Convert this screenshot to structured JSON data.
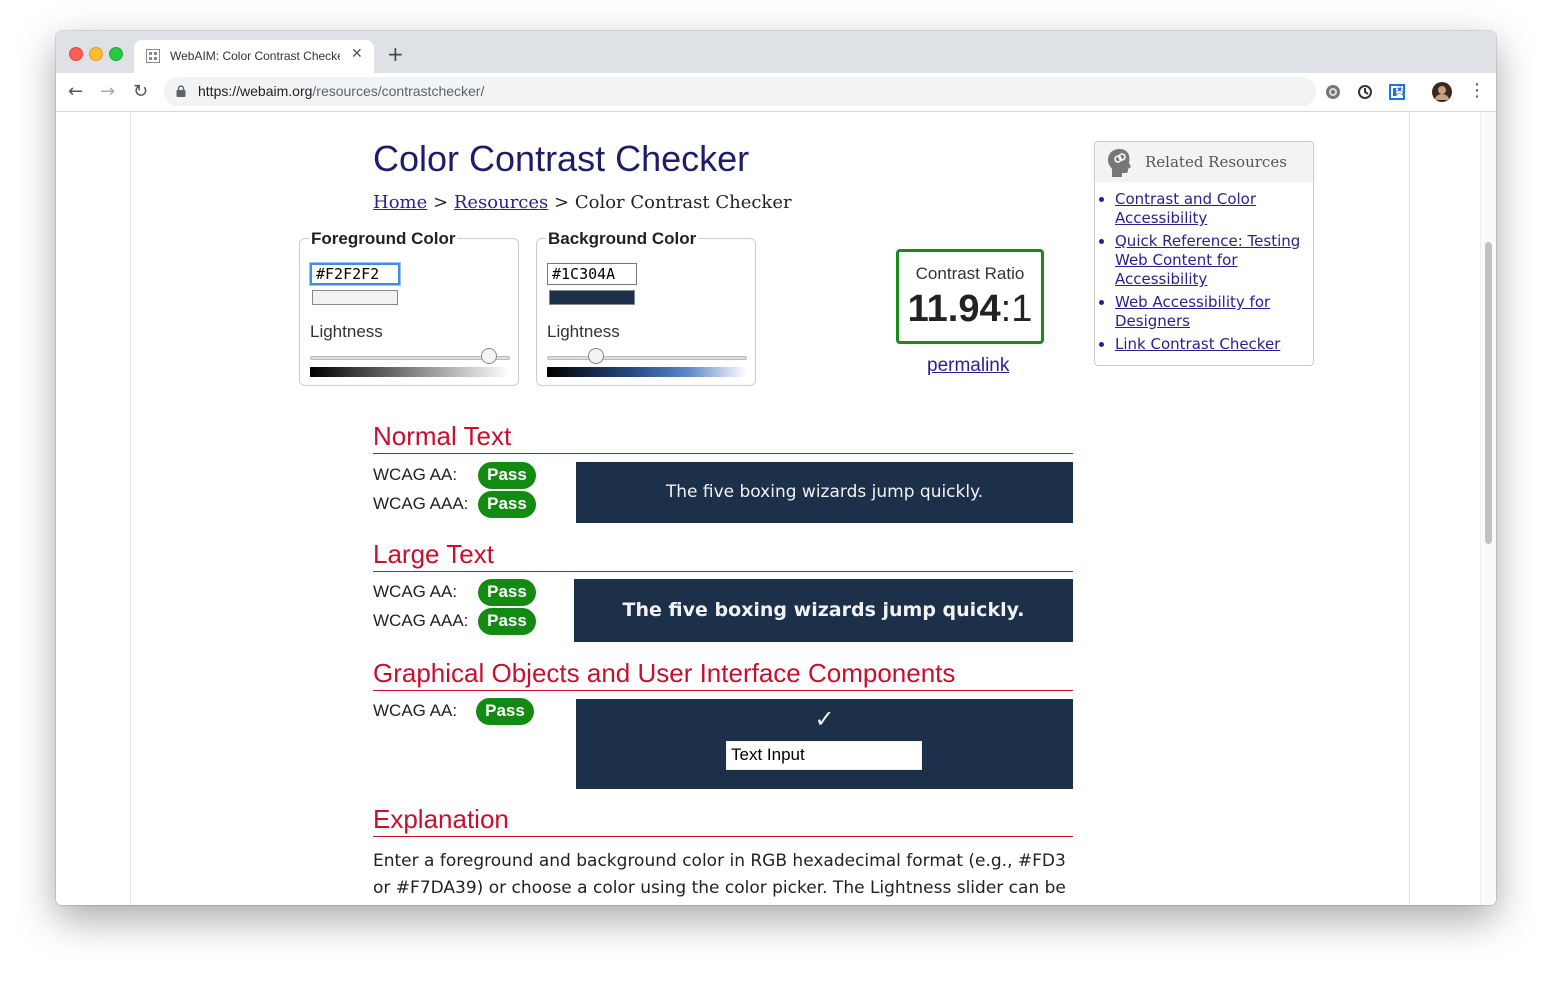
{
  "browser": {
    "tab_title": "WebAIM: Color Contrast Checker",
    "url_host": "https://webaim.org",
    "url_path": "/resources/contrastchecker/"
  },
  "page": {
    "title": "Color Contrast Checker",
    "breadcrumb": {
      "home": "Home",
      "sep1": ">",
      "resources": "Resources",
      "sep2": ">",
      "current": "Color Contrast Checker"
    },
    "foreground": {
      "legend": "Foreground Color",
      "value": "#F2F2F2",
      "lightness_label": "Lightness",
      "lightness_level": 0.92,
      "swatch_color": "#f2f2f2"
    },
    "background": {
      "legend": "Background Color",
      "value": "#1C304A",
      "lightness_label": "Lightness",
      "lightness_level": 0.22,
      "swatch_color": "#1c304a"
    },
    "contrast": {
      "label": "Contrast Ratio",
      "ratio_value": "11.94",
      "ratio_suffix": ":1",
      "permalink": "permalink"
    },
    "normal_text": {
      "heading": "Normal Text",
      "aa_label": "WCAG AA:",
      "aa_result": "Pass",
      "aaa_label": "WCAG AAA:",
      "aaa_result": "Pass",
      "sample": "The five boxing wizards jump quickly."
    },
    "large_text": {
      "heading": "Large Text",
      "aa_label": "WCAG AA:",
      "aa_result": "Pass",
      "aaa_label": "WCAG AAA:",
      "aaa_result": "Pass",
      "sample": "The five boxing wizards jump quickly."
    },
    "graphical": {
      "heading": "Graphical Objects and User Interface Components",
      "aa_label": "WCAG AA:",
      "aa_result": "Pass",
      "check_glyph": "✓",
      "input_value": "Text Input"
    },
    "explanation": {
      "heading": "Explanation",
      "text": "Enter a foreground and background color in RGB hexadecimal format (e.g., #FD3 or #F7DA39) or choose a color using the color picker. The Lightness slider can be used"
    },
    "related": {
      "title": "Related Resources",
      "links": [
        "Contrast and Color Accessibility",
        "Quick Reference: Testing Web Content for Accessibility",
        "Web Accessibility for Designers",
        "Link Contrast Checker"
      ]
    }
  },
  "colors": {
    "heading_red": "#c8102e",
    "pass_green": "#138a13",
    "link_blue": "#2a1f8f",
    "demo_bg": "#1c304a",
    "demo_fg": "#f2f2f2"
  }
}
